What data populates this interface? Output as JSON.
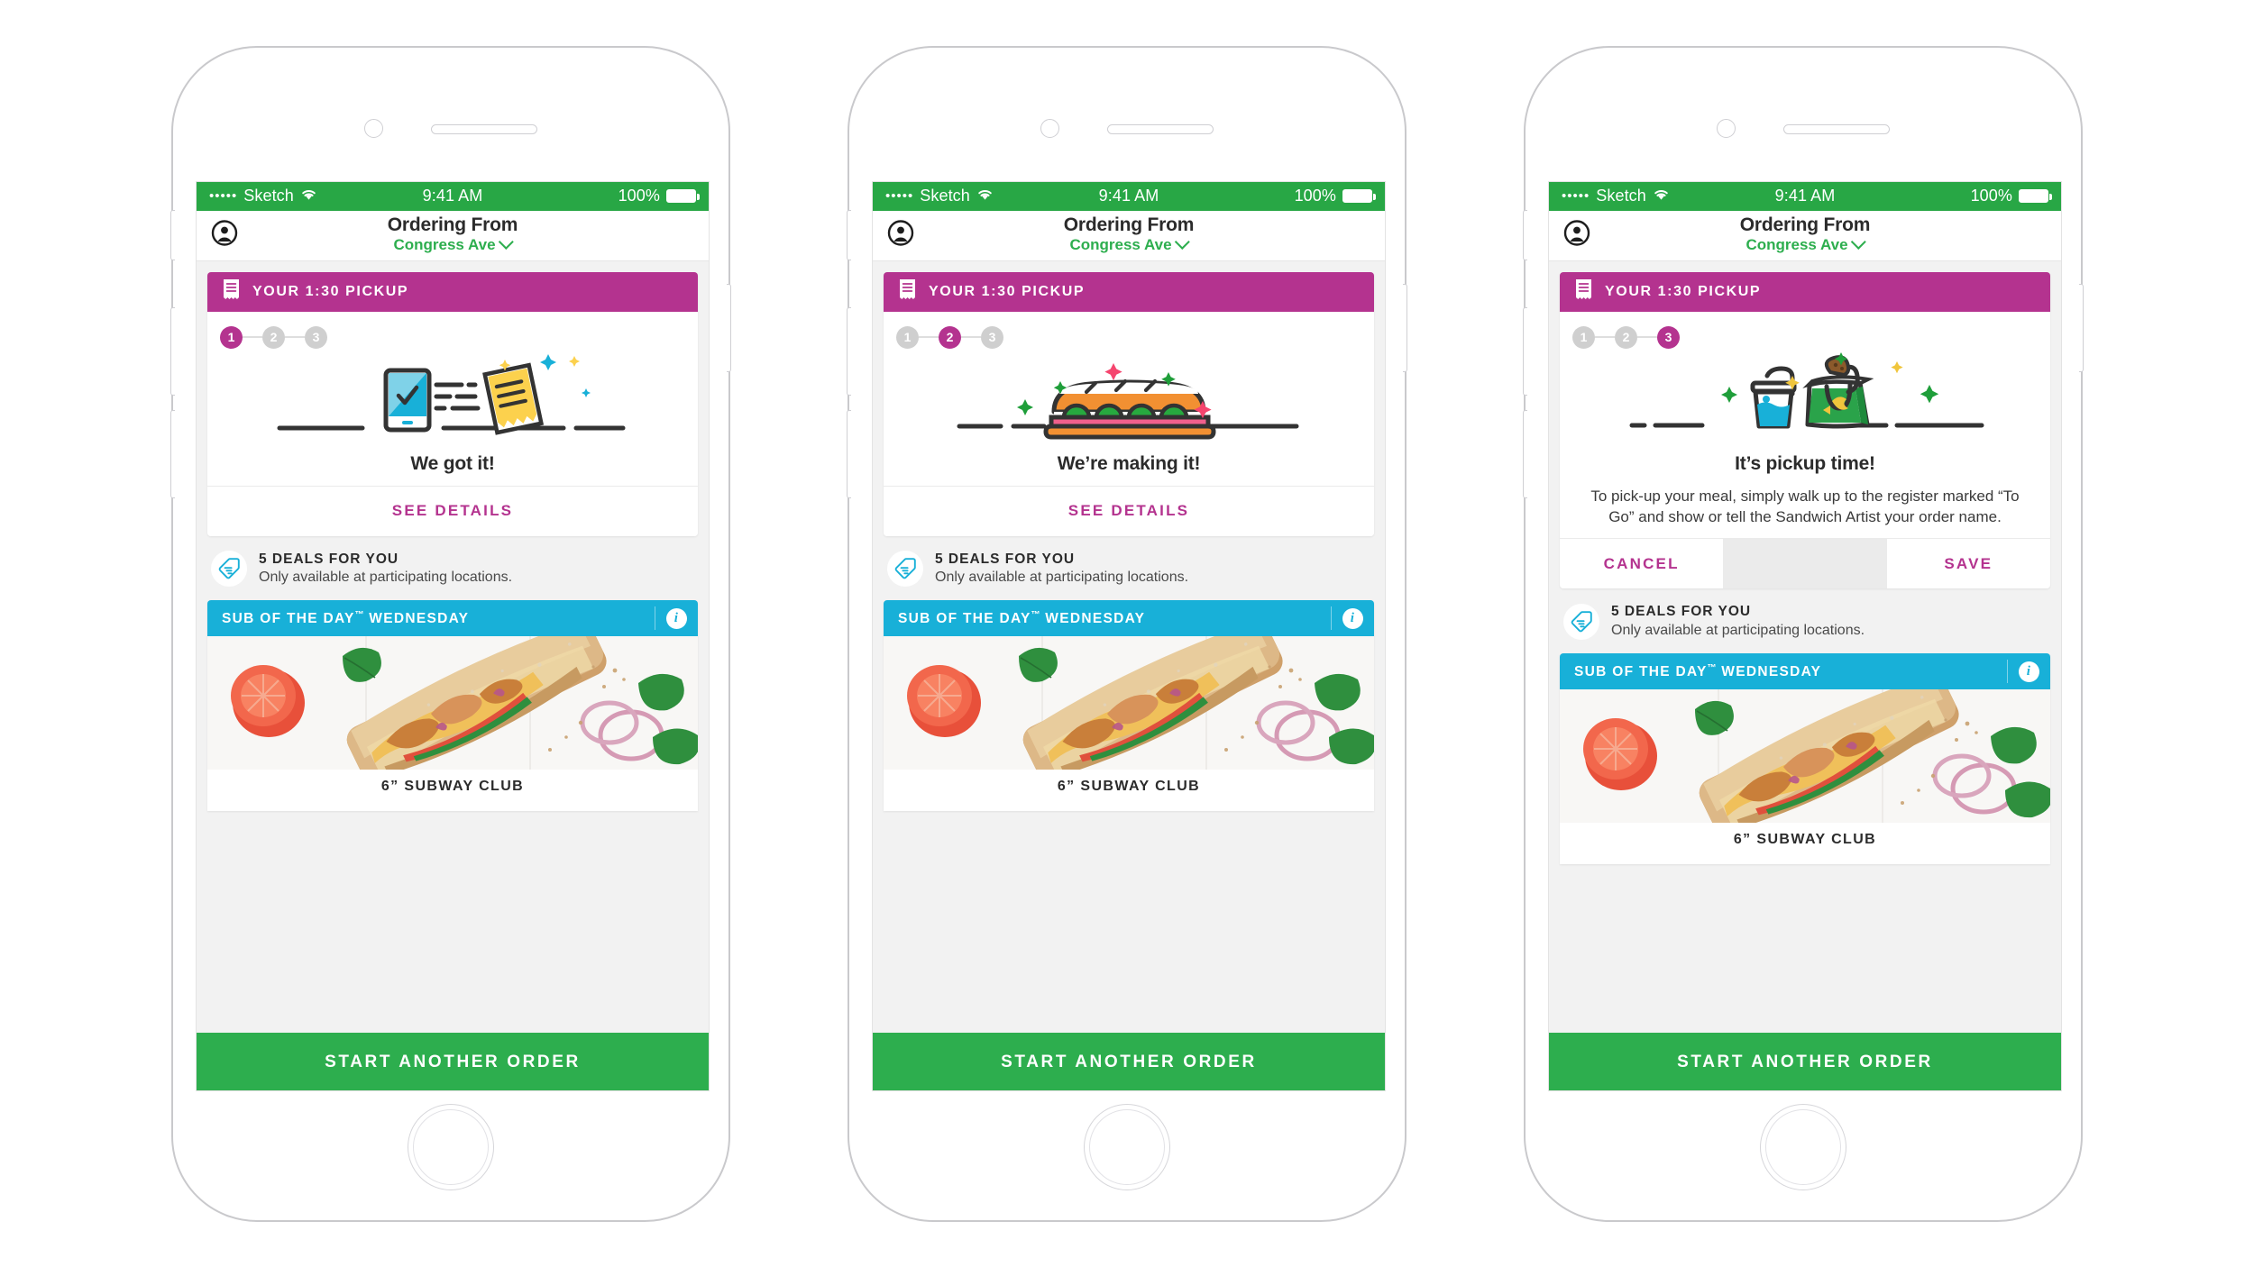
{
  "status_bar": {
    "signal_dots": "•••••",
    "carrier": "Sketch",
    "wifi_icon": "wifi-icon",
    "time": "9:41 AM",
    "battery_percent": "100%"
  },
  "nav": {
    "avatar_icon": "account-circle-icon",
    "title": "Ordering From",
    "location": "Congress Ave",
    "chevron_icon": "chevron-down-icon"
  },
  "order_card": {
    "header_icon": "receipt-icon",
    "header_label": "YOUR 1:30 PICKUP",
    "steps": [
      "1",
      "2",
      "3"
    ],
    "see_details_label": "SEE DETAILS",
    "cancel_label": "CANCEL",
    "save_label": "SAVE"
  },
  "deals": {
    "tag_icon": "tag-icon",
    "title": "5 DEALS FOR YOU",
    "subtitle": "Only available at participating locations."
  },
  "sub_of_the_day": {
    "label": "SUB OF THE DAY",
    "trademark": "™",
    "day": "WEDNESDAY",
    "info_icon": "info-icon",
    "info_glyph": "i",
    "caption": "6” SUBWAY CLUB"
  },
  "cta": {
    "label": "START ANOTHER ORDER"
  },
  "phones": [
    {
      "id": "phone-1",
      "active_step": 1,
      "illustration": "phone-receipt-illustration",
      "status_text": "We got it!",
      "description": "",
      "actions": "single",
      "card_bottom_label": "SEE DETAILS"
    },
    {
      "id": "phone-2",
      "active_step": 2,
      "illustration": "sandwich-illustration",
      "status_text": "We’re making it!",
      "description": "",
      "actions": "single",
      "card_bottom_label": "SEE DETAILS"
    },
    {
      "id": "phone-3",
      "active_step": 3,
      "illustration": "pickup-bag-drink-illustration",
      "status_text": "It’s pickup time!",
      "description": "To pick-up your meal, simply walk up to the register marked “To Go” and show or tell the Sandwich Artist your order name.",
      "actions": "double",
      "card_bottom_label": ""
    }
  ],
  "colors": {
    "brand_green": "#2dae4e",
    "status_green": "#28a745",
    "magenta": "#b4338f",
    "cyan": "#18b0d8",
    "text_dark": "#2b2b2b",
    "screen_bg": "#f2f2f2"
  }
}
